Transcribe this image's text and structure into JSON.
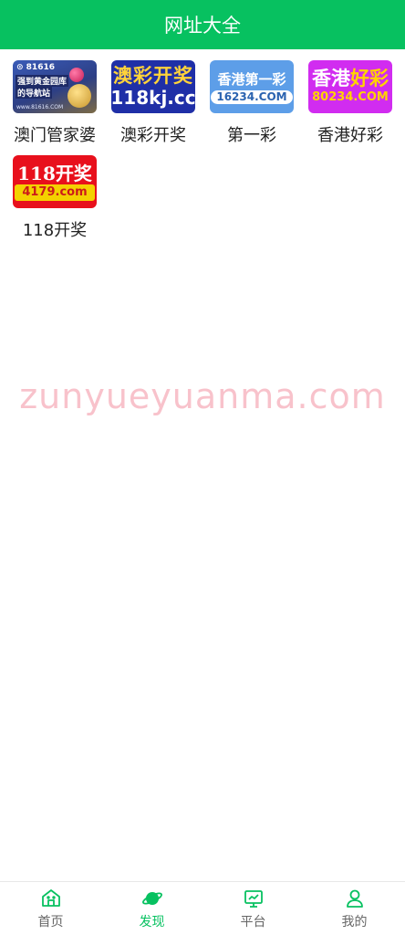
{
  "header": {
    "title": "网址大全"
  },
  "tiles": [
    {
      "label": "澳门管家婆",
      "thumb": {
        "line1": "⊙ 81616",
        "line2": "强到黄金园库",
        "line3": "的导航站",
        "line4": "www.81616.COM"
      }
    },
    {
      "label": "澳彩开奖",
      "thumb": {
        "line1": "澳彩开奖",
        "line2": "118kj.cc"
      }
    },
    {
      "label": "第一彩",
      "thumb": {
        "line1": "香港第一彩",
        "line2": "16234.COM"
      }
    },
    {
      "label": "香港好彩",
      "thumb": {
        "line1a": "香港",
        "line1b": "好彩",
        "line2": "80234.COM"
      }
    },
    {
      "label": "118开奖",
      "thumb": {
        "line1": "118开奖",
        "line2a": "4179",
        "line2b": ".com"
      }
    }
  ],
  "watermark": "zunyueyuanma.com",
  "tabbar": {
    "active": "discover",
    "accent": "#07c160",
    "items": [
      {
        "key": "home",
        "label": "首页",
        "icon": "home-icon"
      },
      {
        "key": "discover",
        "label": "发现",
        "icon": "planet-icon"
      },
      {
        "key": "platform",
        "label": "平台",
        "icon": "monitor-icon"
      },
      {
        "key": "me",
        "label": "我的",
        "icon": "user-icon"
      }
    ]
  }
}
